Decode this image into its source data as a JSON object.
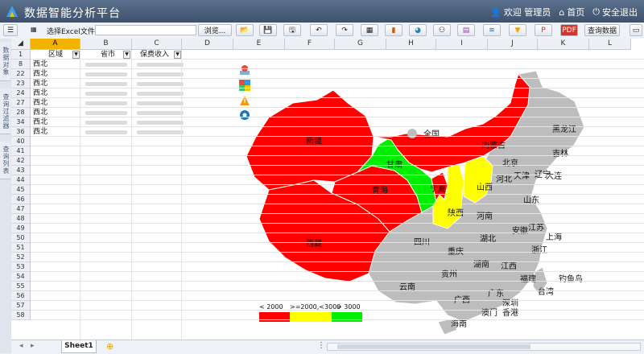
{
  "app": {
    "title": "数据智能分析平台",
    "welcome": "欢迎 管理员",
    "home": "首页",
    "logout": "安全退出"
  },
  "toolbar": {
    "file_label": "选择Excel文件:",
    "browse": "浏览...",
    "query": "查询数据"
  },
  "side_tabs": [
    "数据对象",
    "查询过滤器",
    "查询列表"
  ],
  "sheet": {
    "columns": [
      "A",
      "B",
      "C",
      "D",
      "E",
      "F",
      "G",
      "H",
      "I",
      "J",
      "K",
      "L"
    ],
    "header_row": {
      "num": "1",
      "a": "区域",
      "b": "省市",
      "c": "保费收入"
    },
    "rows": [
      {
        "num": "8",
        "region": "西北"
      },
      {
        "num": "22",
        "region": "西北"
      },
      {
        "num": "23",
        "region": "西北"
      },
      {
        "num": "24",
        "region": "西北"
      },
      {
        "num": "27",
        "region": "西北"
      },
      {
        "num": "28",
        "region": "西北"
      },
      {
        "num": "34",
        "region": "西北"
      },
      {
        "num": "36",
        "region": "西北"
      },
      {
        "num": "40"
      },
      {
        "num": "41"
      },
      {
        "num": "42"
      },
      {
        "num": "43"
      },
      {
        "num": "44"
      },
      {
        "num": "45"
      },
      {
        "num": "46"
      },
      {
        "num": "47"
      },
      {
        "num": "48"
      },
      {
        "num": "49"
      },
      {
        "num": "50"
      },
      {
        "num": "51"
      },
      {
        "num": "52"
      },
      {
        "num": "53"
      },
      {
        "num": "54"
      },
      {
        "num": "55"
      },
      {
        "num": "56"
      },
      {
        "num": "57"
      },
      {
        "num": "58"
      }
    ],
    "tab": "Sheet1"
  },
  "map": {
    "national": "全国",
    "regions": [
      {
        "name": "新疆",
        "level": "low"
      },
      {
        "name": "西藏",
        "level": "low"
      },
      {
        "name": "青海",
        "level": "low"
      },
      {
        "name": "内蒙古",
        "level": "low"
      },
      {
        "name": "甘肃",
        "level": "high"
      },
      {
        "name": "宁夏",
        "level": "low"
      },
      {
        "name": "陕西",
        "level": "mid"
      },
      {
        "name": "山西",
        "level": "mid"
      },
      {
        "name": "黑龙江",
        "level": "none"
      },
      {
        "name": "吉林",
        "level": "none"
      },
      {
        "name": "辽宁",
        "level": "none"
      },
      {
        "name": "北京",
        "level": "none"
      },
      {
        "name": "天津",
        "level": "none"
      },
      {
        "name": "大连",
        "level": "none"
      },
      {
        "name": "河北",
        "level": "none"
      },
      {
        "name": "山东",
        "level": "none"
      },
      {
        "name": "河南",
        "level": "none"
      },
      {
        "name": "江苏",
        "level": "none"
      },
      {
        "name": "安徽",
        "level": "none"
      },
      {
        "name": "上海",
        "level": "none"
      },
      {
        "name": "四川",
        "level": "none"
      },
      {
        "name": "湖北",
        "level": "none"
      },
      {
        "name": "浙江",
        "level": "none"
      },
      {
        "name": "重庆",
        "level": "none"
      },
      {
        "name": "湖南",
        "level": "none"
      },
      {
        "name": "江西",
        "level": "none"
      },
      {
        "name": "贵州",
        "level": "none"
      },
      {
        "name": "福建",
        "level": "none"
      },
      {
        "name": "钓鱼岛",
        "level": "none"
      },
      {
        "name": "云南",
        "level": "none"
      },
      {
        "name": "广西",
        "level": "none"
      },
      {
        "name": "广东",
        "level": "none"
      },
      {
        "name": "台湾",
        "level": "none"
      },
      {
        "name": "深圳",
        "level": "none"
      },
      {
        "name": "澳门",
        "level": "none"
      },
      {
        "name": "香港",
        "level": "none"
      },
      {
        "name": "海南",
        "level": "none"
      }
    ],
    "legend": [
      {
        "label": "< 2000",
        "color": "#ff0000"
      },
      {
        "label": ">=2000,<3000",
        "color": "#ffff00"
      },
      {
        "label": "> 3000",
        "color": "#00ee00"
      }
    ],
    "colors": {
      "low": "#ff0000",
      "mid": "#ffff00",
      "high": "#00ee00",
      "none": "#bdbdbd"
    }
  }
}
